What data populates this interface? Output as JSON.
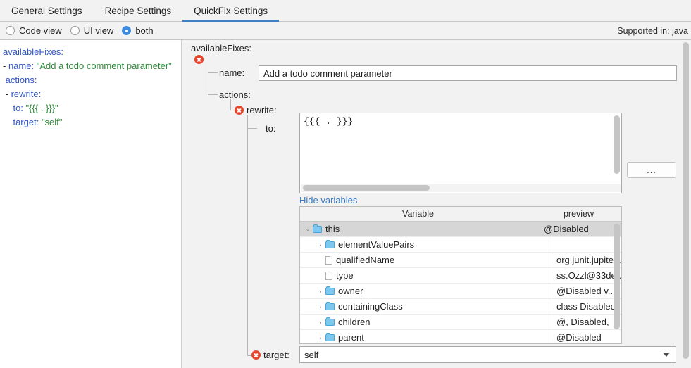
{
  "tabs": [
    {
      "label": "General Settings",
      "active": false
    },
    {
      "label": "Recipe Settings",
      "active": false
    },
    {
      "label": "QuickFix Settings",
      "active": true
    }
  ],
  "view_modes": {
    "options": [
      {
        "label": "Code view",
        "selected": false
      },
      {
        "label": "UI view",
        "selected": false
      },
      {
        "label": "both",
        "selected": true
      }
    ],
    "supported_in": "Supported in: java"
  },
  "code_view": {
    "lines": [
      [
        {
          "t": "availableFixes:",
          "c": "k"
        }
      ],
      [
        {
          "t": "- ",
          "c": "p"
        },
        {
          "t": "name:",
          "c": "k"
        },
        {
          "t": " ",
          "c": "p"
        },
        {
          "t": "\"Add a todo comment parameter\"",
          "c": "s"
        }
      ],
      [
        {
          "t": " ",
          "c": "p"
        },
        {
          "t": "actions:",
          "c": "k"
        }
      ],
      [
        {
          "t": " - ",
          "c": "p"
        },
        {
          "t": "rewrite:",
          "c": "k"
        }
      ],
      [
        {
          "t": "    ",
          "c": "p"
        },
        {
          "t": "to:",
          "c": "k"
        },
        {
          "t": " ",
          "c": "p"
        },
        {
          "t": "\"{{{ . }}}\"",
          "c": "s"
        }
      ],
      [
        {
          "t": "    ",
          "c": "p"
        },
        {
          "t": "target:",
          "c": "k"
        },
        {
          "t": " ",
          "c": "p"
        },
        {
          "t": "\"self\"",
          "c": "s"
        }
      ]
    ]
  },
  "ui_view": {
    "root_label": "availableFixes:",
    "name_label": "name:",
    "name_value": "Add a todo comment parameter",
    "actions_label": "actions:",
    "rewrite_label": "rewrite:",
    "to_label": "to:",
    "to_value": "{{{ . }}}",
    "browse_button": "...",
    "hide_variables_link": "Hide variables",
    "target_label": "target:",
    "target_value": "self",
    "variables_table": {
      "columns": [
        "Variable",
        "preview"
      ],
      "rows": [
        {
          "name": "this",
          "preview": "@Disabled",
          "icon": "folder",
          "chevron": "expanded",
          "indent": 0,
          "selected": true
        },
        {
          "name": "elementValuePairs",
          "preview": "",
          "icon": "folder",
          "chevron": "collapsed",
          "indent": 1,
          "selected": false
        },
        {
          "name": "qualifiedName",
          "preview": "org.junit.jupite...",
          "icon": "file",
          "chevron": "none",
          "indent": 1,
          "selected": false
        },
        {
          "name": "type",
          "preview": "ss.Ozzl@33de...",
          "icon": "file",
          "chevron": "none",
          "indent": 1,
          "selected": false
        },
        {
          "name": "owner",
          "preview": "@Disabled    v...",
          "icon": "folder",
          "chevron": "collapsed",
          "indent": 1,
          "selected": false
        },
        {
          "name": "containingClass",
          "preview": "class Disabled...",
          "icon": "folder",
          "chevron": "collapsed",
          "indent": 1,
          "selected": false
        },
        {
          "name": "children",
          "preview": "@, Disabled,",
          "icon": "folder",
          "chevron": "collapsed",
          "indent": 1,
          "selected": false
        },
        {
          "name": "parent",
          "preview": "@Disabled",
          "icon": "folder",
          "chevron": "collapsed",
          "indent": 1,
          "selected": false
        }
      ]
    }
  },
  "colors": {
    "accent": "#3e7fc4",
    "error": "#e4452c",
    "link": "#3b7dc7",
    "yaml_key": "#2f56c4",
    "yaml_string": "#2d8a37",
    "selection": "#d6d6d6",
    "folder_icon": "#7ec8ef"
  }
}
